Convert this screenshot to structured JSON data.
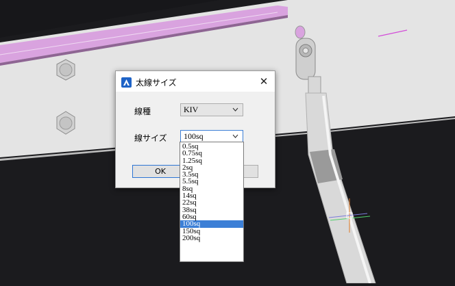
{
  "dialog": {
    "title": "太線サイズ",
    "close_glyph": "✕",
    "wire_type_label": "線種",
    "wire_type_value": "KIV",
    "wire_size_label": "線サイズ",
    "wire_size_value": "100sq",
    "ok_label": "OK",
    "cancel_label": ""
  },
  "dropdown": {
    "options": [
      "0.5sq",
      "0.75sq",
      "1.25sq",
      "2sq",
      "3.5sq",
      "5.5sq",
      "8sq",
      "14sq",
      "22sq",
      "38sq",
      "60sq",
      "100sq",
      "150sq",
      "200sq"
    ],
    "selected_index": 11
  },
  "colors": {
    "accent": "#3c7fd6",
    "app_icon": "#1e63c7",
    "viewport_bg": "#1b1b1e",
    "panel": "#e6e6e6",
    "highlight_edge": "#d9a3df"
  }
}
